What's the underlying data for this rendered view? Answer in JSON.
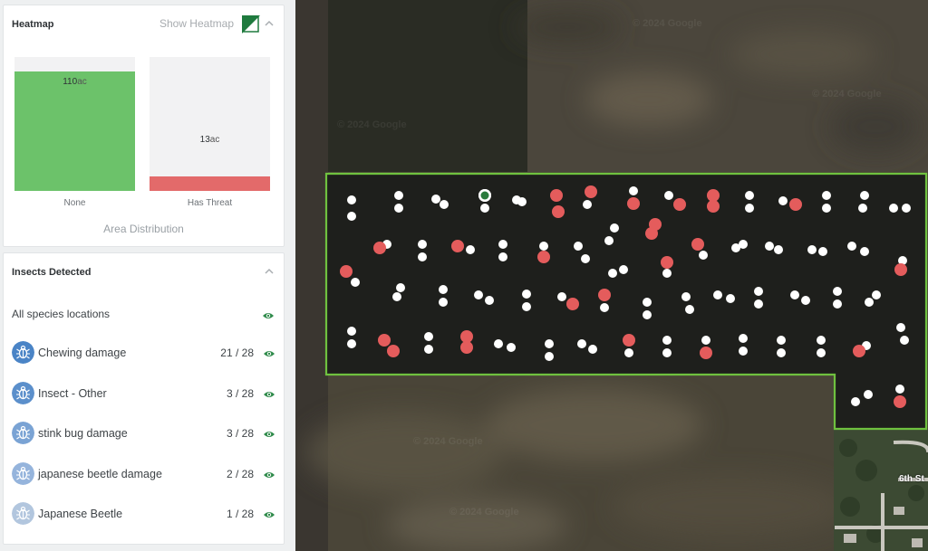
{
  "heatmap": {
    "title": "Heatmap",
    "show_label": "Show Heatmap",
    "bars": [
      {
        "label": "None",
        "value": "110",
        "unit": "ac",
        "fraction": 0.89
      },
      {
        "label": "Has Threat",
        "value": "13",
        "unit": "ac",
        "fraction": 0.105
      }
    ],
    "footer": "Area Distribution"
  },
  "insects": {
    "title": "Insects Detected",
    "all_label": "All species locations",
    "items": [
      {
        "name": "Chewing damage",
        "count": "21 / 28",
        "color": "#4a84c6"
      },
      {
        "name": "Insect - Other",
        "count": "3 / 28",
        "color": "#5b8fcb"
      },
      {
        "name": "stink bug damage",
        "count": "3 / 28",
        "color": "#7aa3d4"
      },
      {
        "name": "japanese beetle damage",
        "count": "2 / 28",
        "color": "#95b4dc"
      },
      {
        "name": "Japanese Beetle",
        "count": "1 / 28",
        "color": "#b2c6de"
      }
    ]
  },
  "map": {
    "watermark": "© 2024 Google",
    "street_label": "6th St",
    "field_border_color": "#6fc13f",
    "marker_colors": {
      "normal": "#ffffff",
      "threat": "#e45c5c",
      "selected": "#2a7a3c"
    }
  }
}
